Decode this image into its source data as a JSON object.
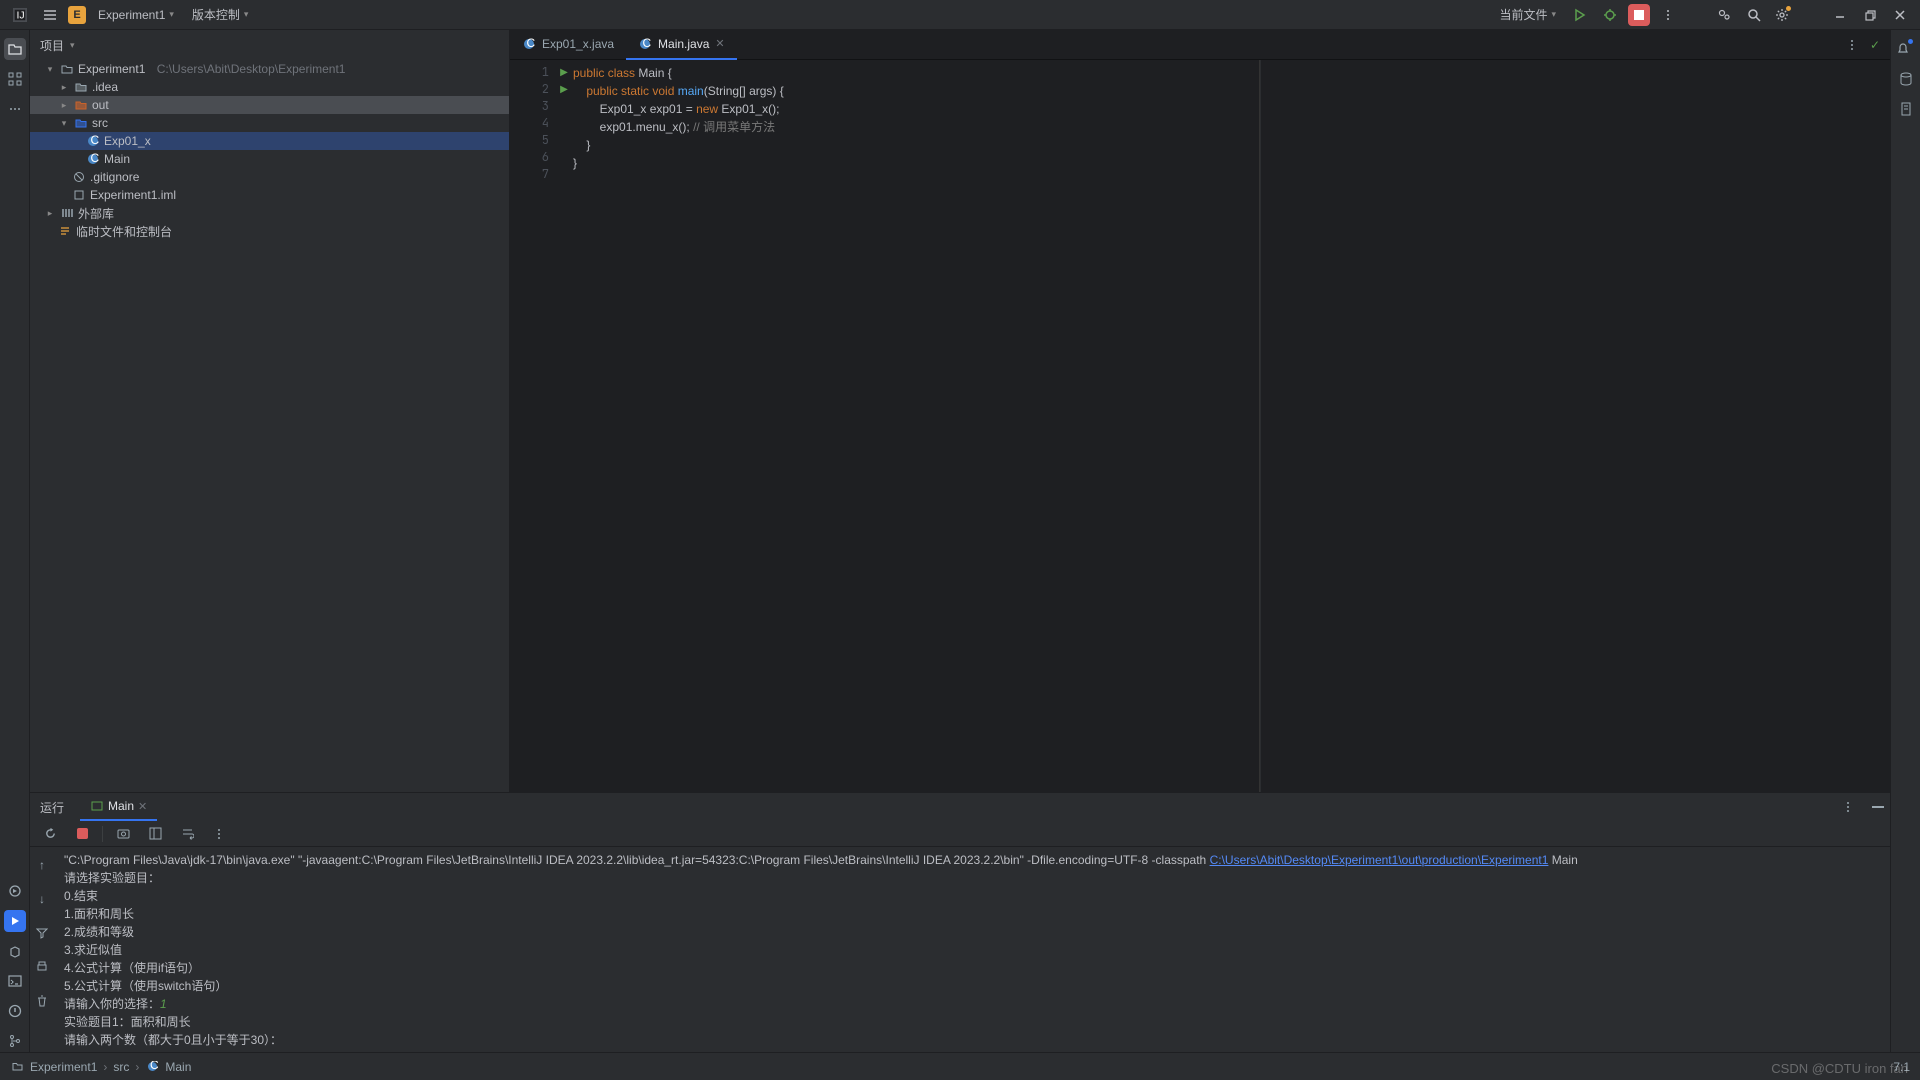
{
  "topbar": {
    "project_badge": "E",
    "project_name": "Experiment1",
    "vcs_label": "版本控制",
    "current_file_label": "当前文件"
  },
  "project_panel": {
    "title": "项目",
    "root_name": "Experiment1",
    "root_path": "C:\\Users\\Abit\\Desktop\\Experiment1",
    "nodes": {
      "idea": ".idea",
      "out": "out",
      "src": "src",
      "exp01": "Exp01_x",
      "main": "Main",
      "gitignore": ".gitignore",
      "iml": "Experiment1.iml",
      "ext_lib": "外部库",
      "scratch": "临时文件和控制台"
    }
  },
  "tabs": {
    "t1": "Exp01_x.java",
    "t2": "Main.java"
  },
  "code": {
    "l1a": "public",
    "l1b": " class ",
    "l1c": "Main {",
    "l2a": "    public static void ",
    "l2b": "main",
    "l2c": "(String[] args) {",
    "l3a": "        Exp01_x exp01 = ",
    "l3b": "new",
    "l3c": " Exp01_x();",
    "l4a": "        exp01.menu_x(); ",
    "l4b": "// 调用菜单方法",
    "l5": "    }",
    "l6": "}",
    "l7": ""
  },
  "gutter": {
    "1": "1",
    "2": "2",
    "3": "3",
    "4": "4",
    "5": "5",
    "6": "6",
    "7": "7"
  },
  "run": {
    "label": "运行",
    "tab": "Main",
    "cmd1": "\"C:\\Program Files\\Java\\jdk-17\\bin\\java.exe\" \"-javaagent:C:\\Program Files\\JetBrains\\IntelliJ IDEA 2023.2.2\\lib\\idea_rt.jar=54323:C:\\Program Files\\JetBrains\\IntelliJ IDEA 2023.2.2\\bin\" -Dfile.encoding=UTF-8 -classpath ",
    "cmd2": "C:\\Users\\Abit\\Desktop\\Experiment1\\out\\production\\Experiment1",
    "cmd3": " Main",
    "out1": "请选择实验题目：",
    "out2": "0.结束",
    "out3": "1.面积和周长",
    "out4": "2.成绩和等级",
    "out5": "3.求近似值",
    "out6": "4.公式计算（使用if语句）",
    "out7": "5.公式计算（使用switch语句）",
    "out8": "请输入你的选择：",
    "inp1": "1",
    "out9": "实验题目1：面积和周长",
    "out10": "请输入两个数（都大于0且小于等于30）："
  },
  "status": {
    "bc1": "Experiment1",
    "bc2": "src",
    "bc3": "Main",
    "pos": "7:1",
    "watermark": "CSDN @CDTU iron fan"
  }
}
